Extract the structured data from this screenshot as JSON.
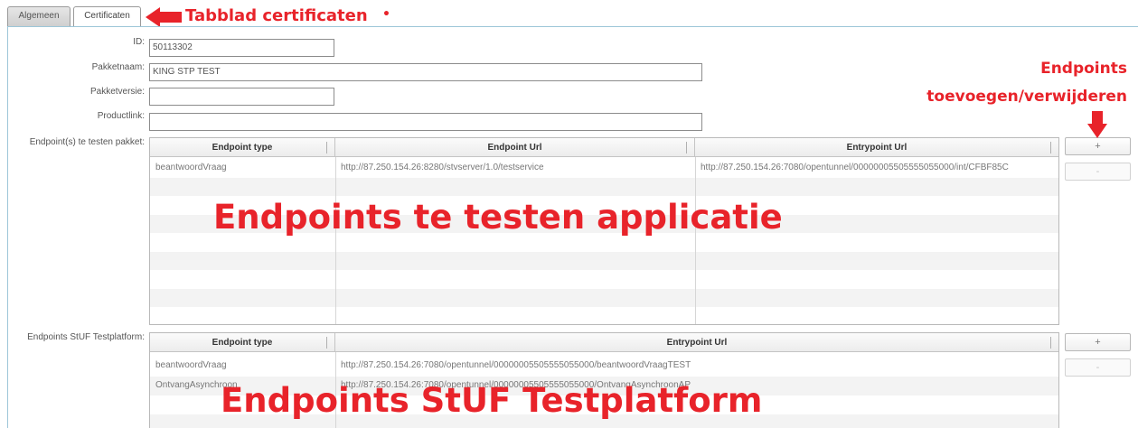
{
  "tabs": [
    {
      "label": "Algemeen",
      "active": false
    },
    {
      "label": "Certificaten",
      "active": true
    }
  ],
  "form": {
    "id_label": "ID:",
    "id_value": "50113302",
    "pakketnaam_label": "Pakketnaam:",
    "pakketnaam_value": "KING STP TEST",
    "pakketversie_label": "Pakketversie:",
    "pakketversie_value": "",
    "productlink_label": "Productlink:",
    "productlink_value": "",
    "endpoints_test_label": "Endpoint(s) te testen pakket:",
    "endpoints_stuf_label": "Endpoints StUF Testplatform:"
  },
  "grid1": {
    "headers": [
      "Endpoint type",
      "Endpoint Url",
      "Entrypoint Url"
    ],
    "rows": [
      [
        "beantwoordVraag",
        "http://87.250.154.26:8280/stvserver/1.0/testservice",
        "http://87.250.154.26:7080/opentunnel/00000005505555055000/int/CFBF85C"
      ]
    ]
  },
  "grid2": {
    "headers": [
      "Endpoint type",
      "Entrypoint Url"
    ],
    "rows": [
      [
        "beantwoordVraag",
        "http://87.250.154.26:7080/opentunnel/00000005505555055000/beantwoordVraagTEST"
      ],
      [
        "OntvangAsynchroon",
        "http://87.250.154.26:7080/opentunnel/00000005505555055000/OntvangAsynchroonAP"
      ]
    ]
  },
  "buttons": {
    "add": "+",
    "remove": "-"
  },
  "annotations": {
    "tab_note": "Tabblad certificaten",
    "dot": "•",
    "endpoints_line1": "Endpoints",
    "endpoints_line2": "toevoegen/verwijderen",
    "grid1_overlay": "Endpoints te testen applicatie",
    "grid2_overlay": "Endpoints StUF Testplatform"
  },
  "colors": {
    "annotation_red": "#e8232a",
    "panel_border": "#9dc6d8"
  }
}
